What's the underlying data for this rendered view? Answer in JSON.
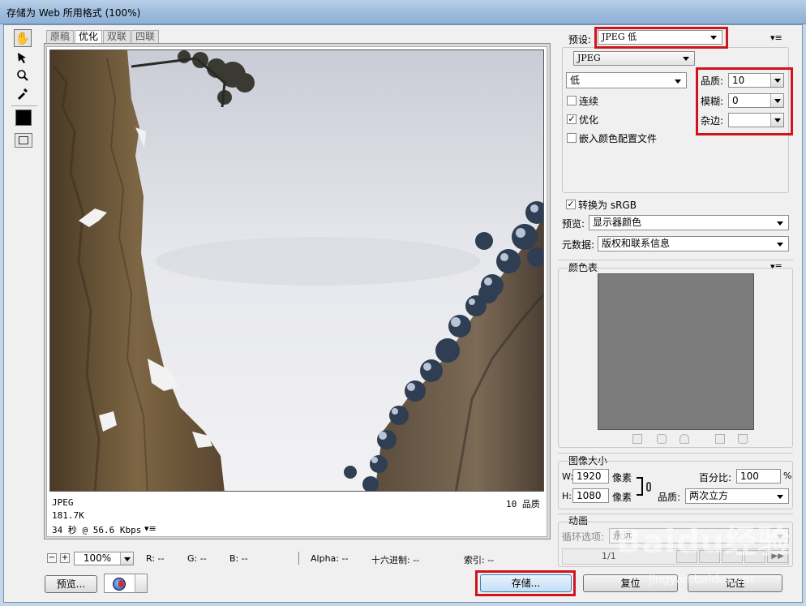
{
  "window": {
    "title": "存储为 Web 所用格式 (100%)"
  },
  "tabs": [
    {
      "label": "原稿"
    },
    {
      "label": "优化"
    },
    {
      "label": "双联"
    },
    {
      "label": "四联"
    }
  ],
  "image_info": {
    "format": "JPEG",
    "size": "181.7K",
    "speed": "34 秒 @ 56.6 Kbps",
    "quality": "10 品质"
  },
  "statusbar": {
    "zoom": "100%",
    "r": "R: --",
    "g": "G: --",
    "b": "B: --",
    "alpha": "Alpha: --",
    "hex": "十六进制: --",
    "index": "索引: --"
  },
  "bottom": {
    "preview_label": "预览...",
    "save_label": "存储...",
    "reset_label": "复位",
    "remember_label": "记住"
  },
  "settings": {
    "preset_label": "预设:",
    "preset_value": "JPEG 低",
    "format_value": "JPEG",
    "compression_value": "低",
    "quality_label": "品质:",
    "quality_value": "10",
    "blur_label": "模糊:",
    "blur_value": "0",
    "matte_label": "杂边:",
    "matte_value": "",
    "progressive": {
      "label": "连续",
      "checked": false
    },
    "optimized": {
      "label": "优化",
      "checked": true
    },
    "embed_profile": {
      "label": "嵌入颜色配置文件",
      "checked": false
    },
    "convert_srgb": {
      "label": "转换为 sRGB",
      "checked": true
    },
    "preview_label": "预览:",
    "preview_value": "显示器颜色",
    "metadata_label": "元数据:",
    "metadata_value": "版权和联系信息"
  },
  "color_table": {
    "title": "颜色表"
  },
  "image_size": {
    "title": "图像大小",
    "w_label": "W:",
    "w_value": "1920",
    "h_label": "H:",
    "h_value": "1080",
    "unit": "像素",
    "percent_label": "百分比:",
    "percent_value": "100",
    "percent_unit": "%",
    "quality_label": "品质:",
    "quality_value": "两次立方"
  },
  "animation": {
    "title": "动画",
    "loop_label": "循环选项:",
    "loop_value": "永远",
    "frame_counter": "1/1"
  },
  "colors": {
    "highlight": "#d0141e",
    "foreground_swatch": "#000000",
    "color_table_bg": "#7b7b7b"
  },
  "watermark": {
    "text": "Baidu经验",
    "url": "jingyan.baidu.com"
  }
}
